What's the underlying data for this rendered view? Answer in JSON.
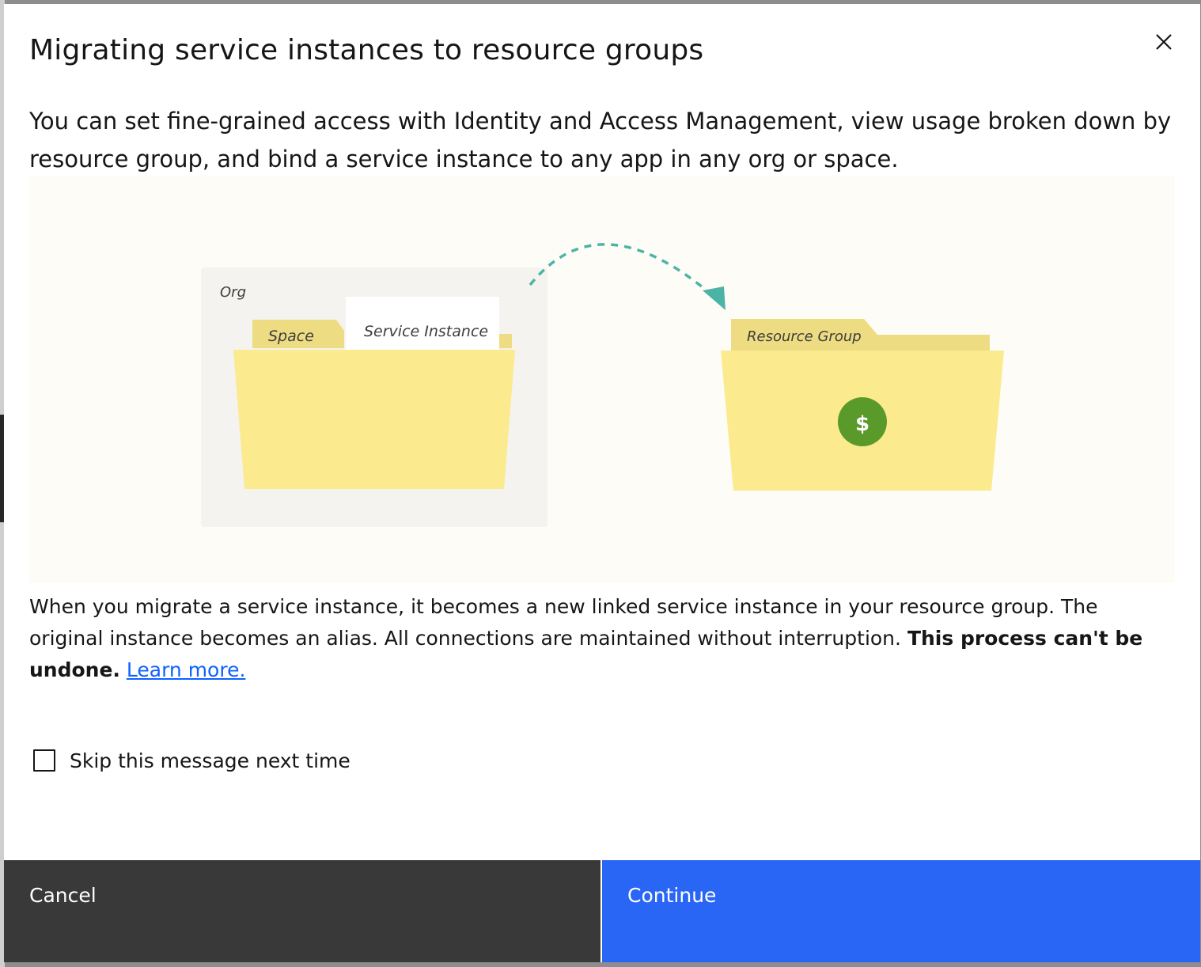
{
  "modal": {
    "title": "Migrating service instances to resource groups",
    "close_icon": "close-icon",
    "intro": "You can set fine-grained access with Identity and Access Management, view usage broken down by resource group, and bind a service instance to any app in any org or space.",
    "illustration": {
      "org_label": "Org",
      "space_label": "Space",
      "service_instance_label": "Service Instance",
      "resource_group_label": "Resource Group",
      "dollar_symbol": "$",
      "icons": [
        "folder-icon",
        "arrow-icon",
        "dollar-icon"
      ],
      "colors": {
        "folder": "#fbea8e",
        "folder_tab": "#eddc82",
        "org_panel": "#f4f3ef",
        "arrow": "#4bb4a6",
        "dollar": "#5a9a2a"
      }
    },
    "body_text_plain": "When you migrate a service instance, it becomes a new linked service instance in your resource group. The original instance becomes an alias. All connections are maintained without interruption.",
    "body_text_bold": "This process can't be undone.",
    "learn_more": "Learn more.",
    "checkbox_label": "Skip this message next time",
    "checkbox_checked": false
  },
  "footer": {
    "cancel_label": "Cancel",
    "continue_label": "Continue",
    "colors": {
      "cancel": "#393939",
      "continue": "#2a66f5"
    }
  }
}
